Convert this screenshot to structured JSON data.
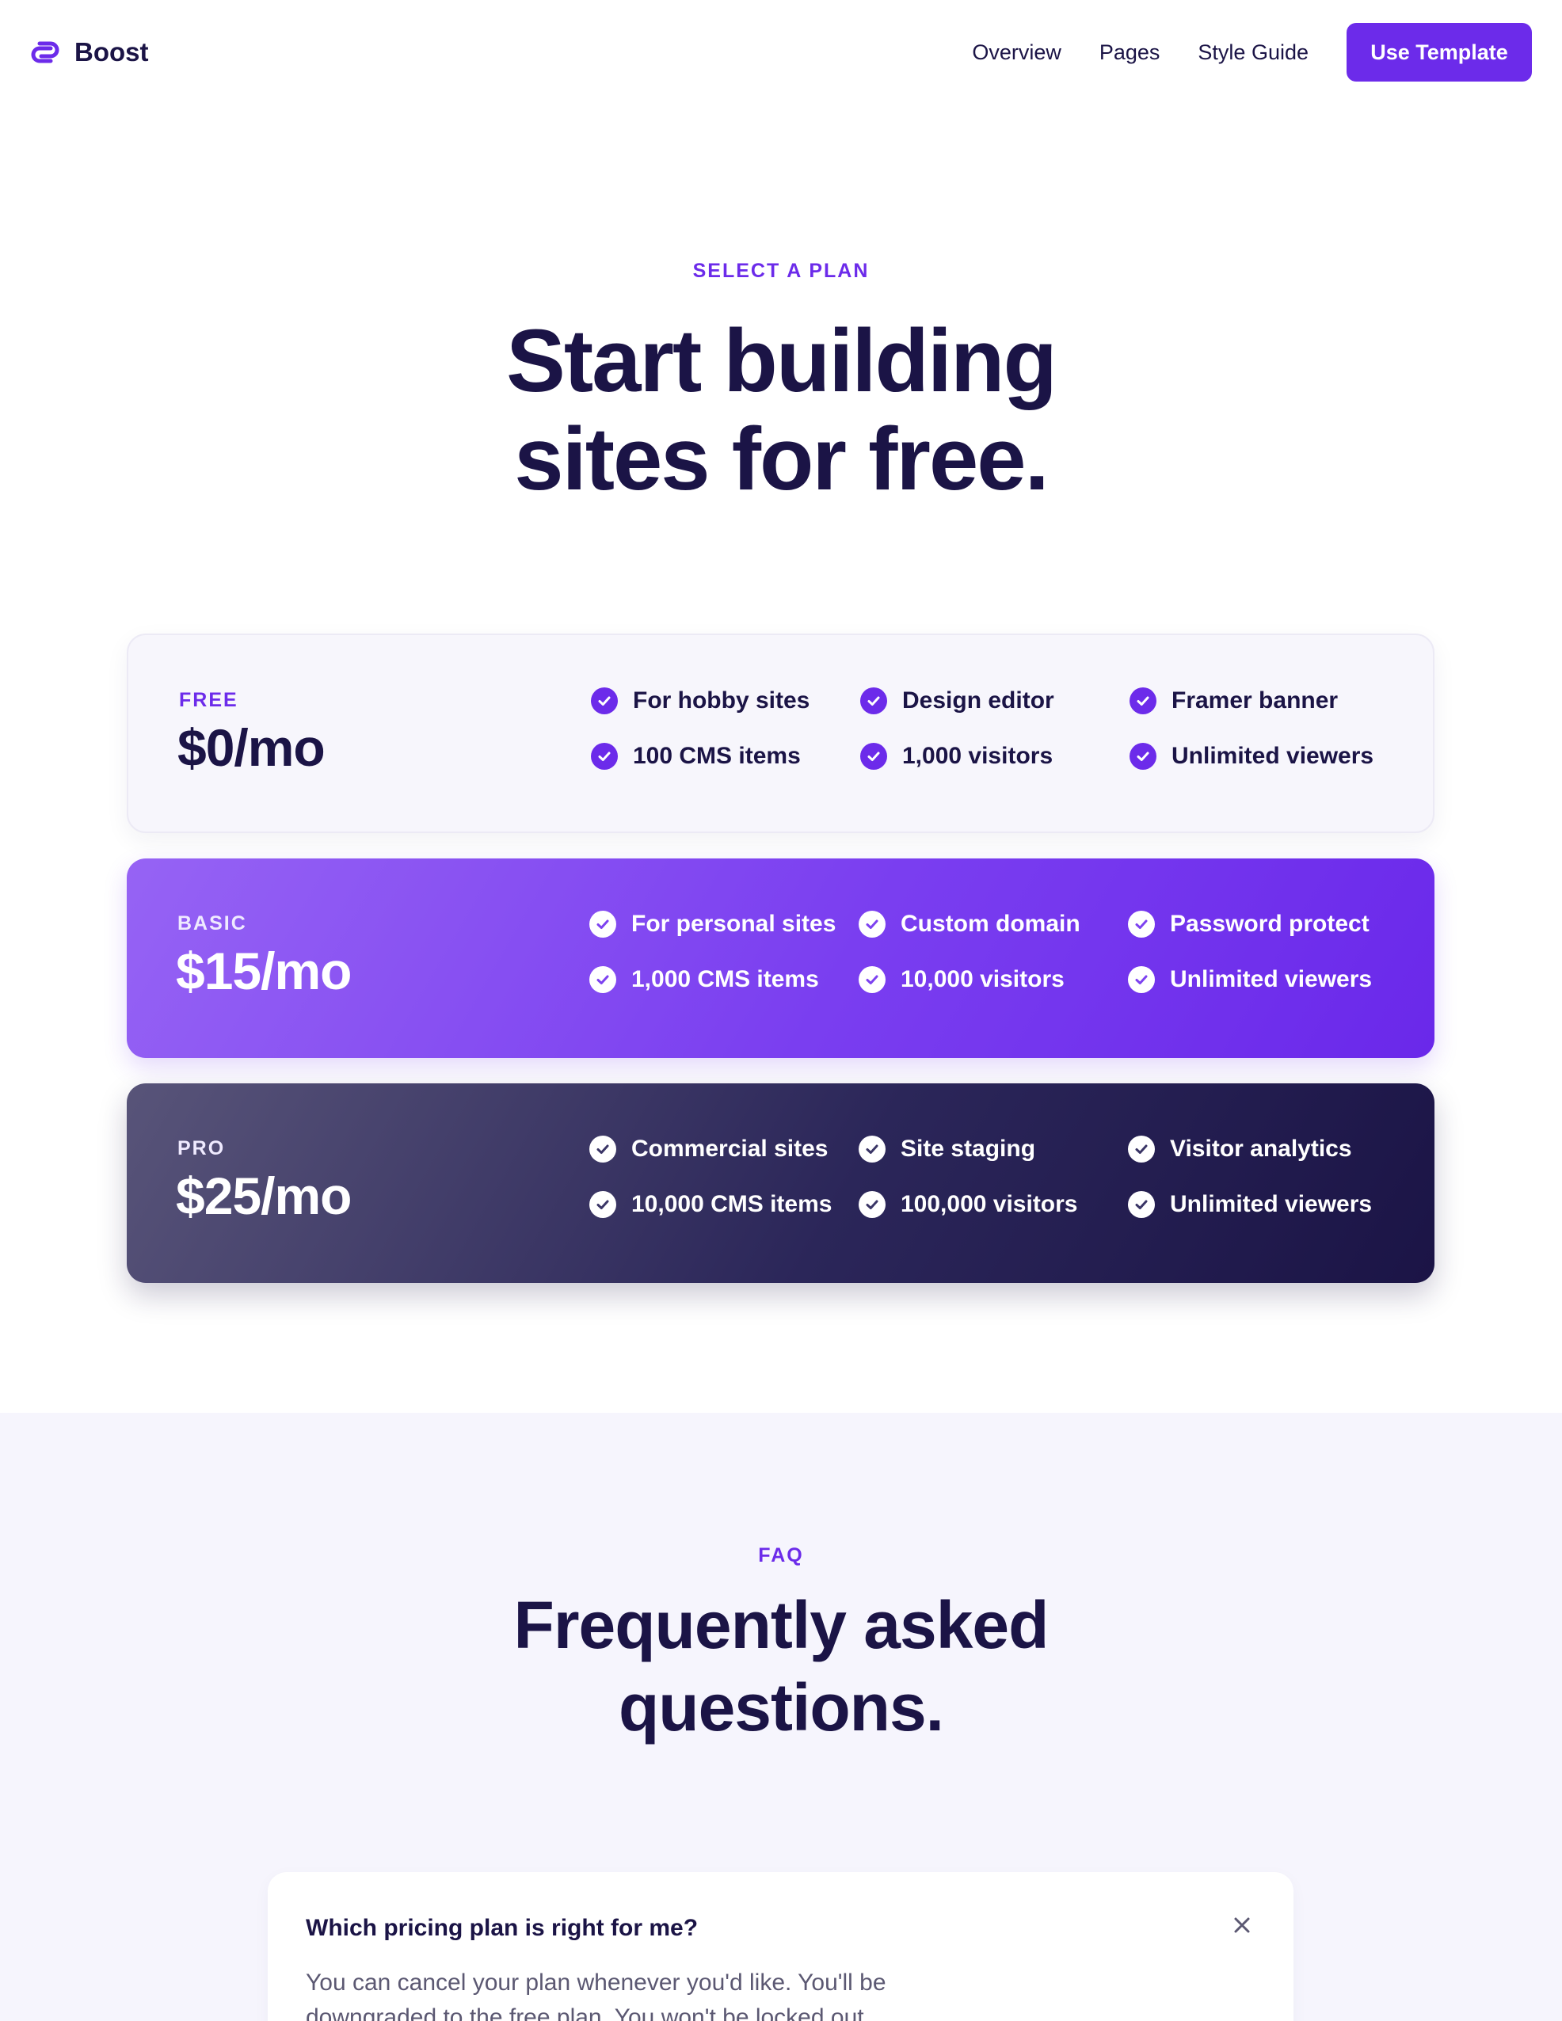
{
  "nav": {
    "brand": "Boost",
    "links": [
      "Overview",
      "Pages",
      "Style Guide"
    ],
    "cta": "Use Template"
  },
  "hero": {
    "eyebrow": "SELECT A PLAN",
    "title_line1": "Start building",
    "title_line2": "sites for free."
  },
  "plans": [
    {
      "tier": "FREE",
      "price": "$0/mo",
      "features": [
        "For hobby sites",
        "Design editor",
        "Framer banner",
        "100 CMS items",
        "1,000 visitors",
        "Unlimited viewers"
      ]
    },
    {
      "tier": "BASIC",
      "price": "$15/mo",
      "features": [
        "For personal sites",
        "Custom domain",
        "Password protect",
        "1,000 CMS items",
        "10,000 visitors",
        "Unlimited viewers"
      ]
    },
    {
      "tier": "PRO",
      "price": "$25/mo",
      "features": [
        "Commercial sites",
        "Site staging",
        "Visitor analytics",
        "10,000 CMS items",
        "100,000 visitors",
        "Unlimited viewers"
      ]
    }
  ],
  "faq": {
    "eyebrow": "FAQ",
    "title_line1": "Frequently asked",
    "title_line2": "questions.",
    "items": [
      {
        "question": "Which pricing plan is right for me?",
        "answer": "You can cancel your plan whenever you'd like. You'll be downgraded to the free plan. You won't be locked out."
      }
    ]
  },
  "colors": {
    "accent": "#6c2bea",
    "navy": "#1b1446",
    "faq_bg": "#f6f5fd"
  },
  "icons": {
    "brand": "boost-logo-icon",
    "check": "check-circle-icon",
    "close": "close-icon"
  }
}
